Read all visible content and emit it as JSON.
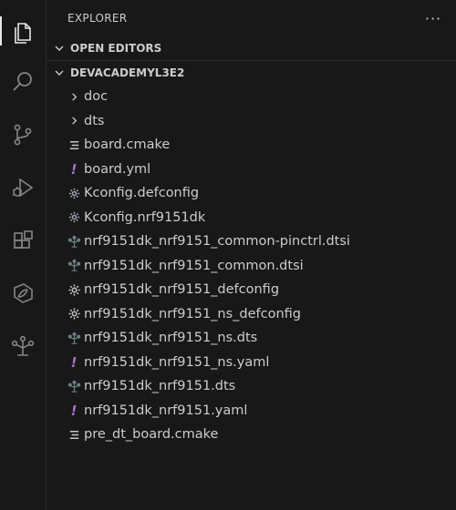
{
  "explorer": {
    "title": "EXPLORER",
    "more_label": "···"
  },
  "sections": {
    "open_editors": "OPEN EDITORS",
    "workspace": "DEVACADEMYL3E2"
  },
  "colors": {
    "background": "#181818",
    "text": "#cccccc",
    "yaml_icon": "#a074c4",
    "settings_icon": "#9da5b4",
    "dts_icon": "#6d8086"
  },
  "activity_icons": [
    "files-icon",
    "search-icon",
    "source-control-icon",
    "run-debug-icon",
    "extensions-icon",
    "nrf-connect-icon",
    "devicetree-icon"
  ],
  "tree": [
    {
      "name": "doc",
      "kind": "folder",
      "icon": "chevron-right-icon"
    },
    {
      "name": "dts",
      "kind": "folder",
      "icon": "chevron-right-icon"
    },
    {
      "name": "board.cmake",
      "kind": "file",
      "icon": "lines-file-icon"
    },
    {
      "name": "board.yml",
      "kind": "file",
      "icon": "yaml-icon"
    },
    {
      "name": "Kconfig.defconfig",
      "kind": "file",
      "icon": "kconfig-gear-icon"
    },
    {
      "name": "Kconfig.nrf9151dk",
      "kind": "file",
      "icon": "kconfig-gear-icon"
    },
    {
      "name": "nrf9151dk_nrf9151_common-pinctrl.dtsi",
      "kind": "file",
      "icon": "devicetree-file-icon"
    },
    {
      "name": "nrf9151dk_nrf9151_common.dtsi",
      "kind": "file",
      "icon": "devicetree-file-icon"
    },
    {
      "name": "nrf9151dk_nrf9151_defconfig",
      "kind": "file",
      "icon": "settings-gear-icon"
    },
    {
      "name": "nrf9151dk_nrf9151_ns_defconfig",
      "kind": "file",
      "icon": "settings-gear-icon"
    },
    {
      "name": "nrf9151dk_nrf9151_ns.dts",
      "kind": "file",
      "icon": "devicetree-file-icon"
    },
    {
      "name": "nrf9151dk_nrf9151_ns.yaml",
      "kind": "file",
      "icon": "yaml-icon"
    },
    {
      "name": "nrf9151dk_nrf9151.dts",
      "kind": "file",
      "icon": "devicetree-file-icon"
    },
    {
      "name": "nrf9151dk_nrf9151.yaml",
      "kind": "file",
      "icon": "yaml-icon"
    },
    {
      "name": "pre_dt_board.cmake",
      "kind": "file",
      "icon": "lines-file-icon"
    }
  ]
}
